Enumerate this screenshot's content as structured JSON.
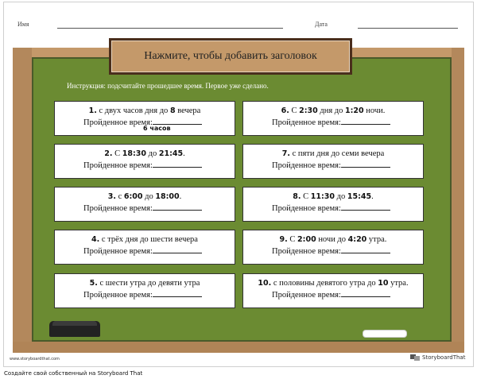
{
  "header": {
    "name_label": "Имя",
    "date_label": "Дата"
  },
  "title": "Нажмите, чтобы добавить заголовок",
  "instruction": "Инструкция: подсчитайте прошедшее время. Первое уже сделано.",
  "answer_label": "Пройденное время:",
  "questions": [
    {
      "num": "1.",
      "parts": [
        [
          "с двух часов дня до ",
          false
        ],
        [
          "8",
          true
        ],
        [
          " вечера",
          false
        ]
      ],
      "answer": "6 часов"
    },
    {
      "num": "2.",
      "parts": [
        [
          "С ",
          false
        ],
        [
          "18:30",
          true
        ],
        [
          " до ",
          false
        ],
        [
          "21:45",
          true
        ],
        [
          ".",
          false
        ]
      ]
    },
    {
      "num": "3.",
      "parts": [
        [
          "с ",
          false
        ],
        [
          "6:00",
          true
        ],
        [
          " до ",
          false
        ],
        [
          "18:00",
          true
        ],
        [
          ".",
          false
        ]
      ]
    },
    {
      "num": "4.",
      "parts": [
        [
          "с трёх дня до шести вечера",
          false
        ]
      ]
    },
    {
      "num": "5.",
      "parts": [
        [
          "с шести утра до девяти утра",
          false
        ]
      ]
    },
    {
      "num": "6.",
      "parts": [
        [
          "С ",
          false
        ],
        [
          "2:30",
          true
        ],
        [
          " дня до ",
          false
        ],
        [
          "1:20",
          true
        ],
        [
          " ночи.",
          false
        ]
      ]
    },
    {
      "num": "7.",
      "parts": [
        [
          "с пяти дня до семи вечера",
          false
        ]
      ]
    },
    {
      "num": "8.",
      "parts": [
        [
          "С ",
          false
        ],
        [
          "11:30",
          true
        ],
        [
          " до ",
          false
        ],
        [
          "15:45",
          true
        ],
        [
          ".",
          false
        ]
      ]
    },
    {
      "num": "9.",
      "parts": [
        [
          "С ",
          false
        ],
        [
          "2:00",
          true
        ],
        [
          " ночи до ",
          false
        ],
        [
          "4:20",
          true
        ],
        [
          " утра.",
          false
        ]
      ]
    },
    {
      "num": "10.",
      "parts": [
        [
          "с половины девятого утра до ",
          false
        ],
        [
          "10",
          true
        ],
        [
          " утра.",
          false
        ]
      ]
    }
  ],
  "footer": {
    "url": "www.storyboardthat.com",
    "logo": "StoryboardThat"
  },
  "bottom_text": "Создайте свой собственный на Storyboard That"
}
